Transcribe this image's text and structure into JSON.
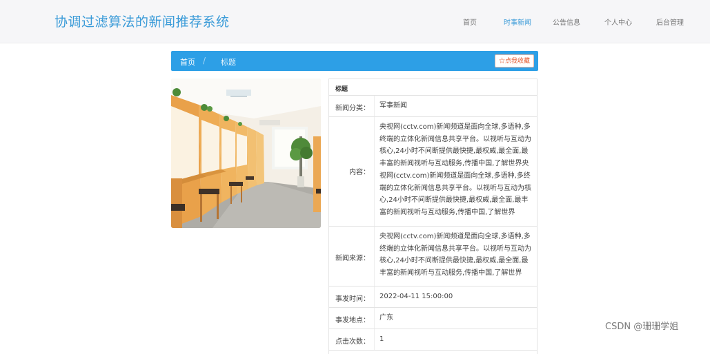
{
  "header": {
    "site_title": "协调过滤算法的新闻推荐系统",
    "nav": [
      {
        "label": "首页",
        "active": false
      },
      {
        "label": "时事新闻",
        "active": true
      },
      {
        "label": "公告信息",
        "active": false
      },
      {
        "label": "个人中心",
        "active": false
      },
      {
        "label": "后台管理",
        "active": false
      }
    ]
  },
  "breadcrumb": {
    "home": "首页",
    "separator": "/",
    "current": "标题",
    "favorite_button": "☆点我收藏"
  },
  "detail": {
    "header_label": "标题",
    "category_label": "新闻分类：",
    "category_value": "军事新闻",
    "content_label": "内容：",
    "content_value": "央视网(cctv.com)新闻频道是面向全球,多语种,多终端的立体化新闻信息共享平台。以视听与互动为核心,24小时不间断提供最快捷,最权威,最全面,最丰富的新闻视听与互动服务,传播中国,了解世界央视网(cctv.com)新闻频道是面向全球,多语种,多终端的立体化新闻信息共享平台。以视听与互动为核心,24小时不间断提供最快捷,最权威,最全面,最丰富的新闻视听与互动服务,传播中国,了解世界",
    "source_label": "新闻来源：",
    "source_value": "央视网(cctv.com)新闻频道是面向全球,多语种,多终端的立体化新闻信息共享平台。以视听与互动为核心,24小时不间断提供最快捷,最权威,最全面,最丰富的新闻视听与互动服务,传播中国,了解世界",
    "time_label": "事发时间：",
    "time_value": "2022-04-11 15:00:00",
    "place_label": "事发地点：",
    "place_value": "广东",
    "clicks_label": "点击次数：",
    "clicks_value": "1"
  },
  "watermark": "CSDN @珊珊学姐",
  "colors": {
    "accent": "#2d9fe6",
    "title": "#3a9bd8",
    "favorite": "#e3572d"
  }
}
